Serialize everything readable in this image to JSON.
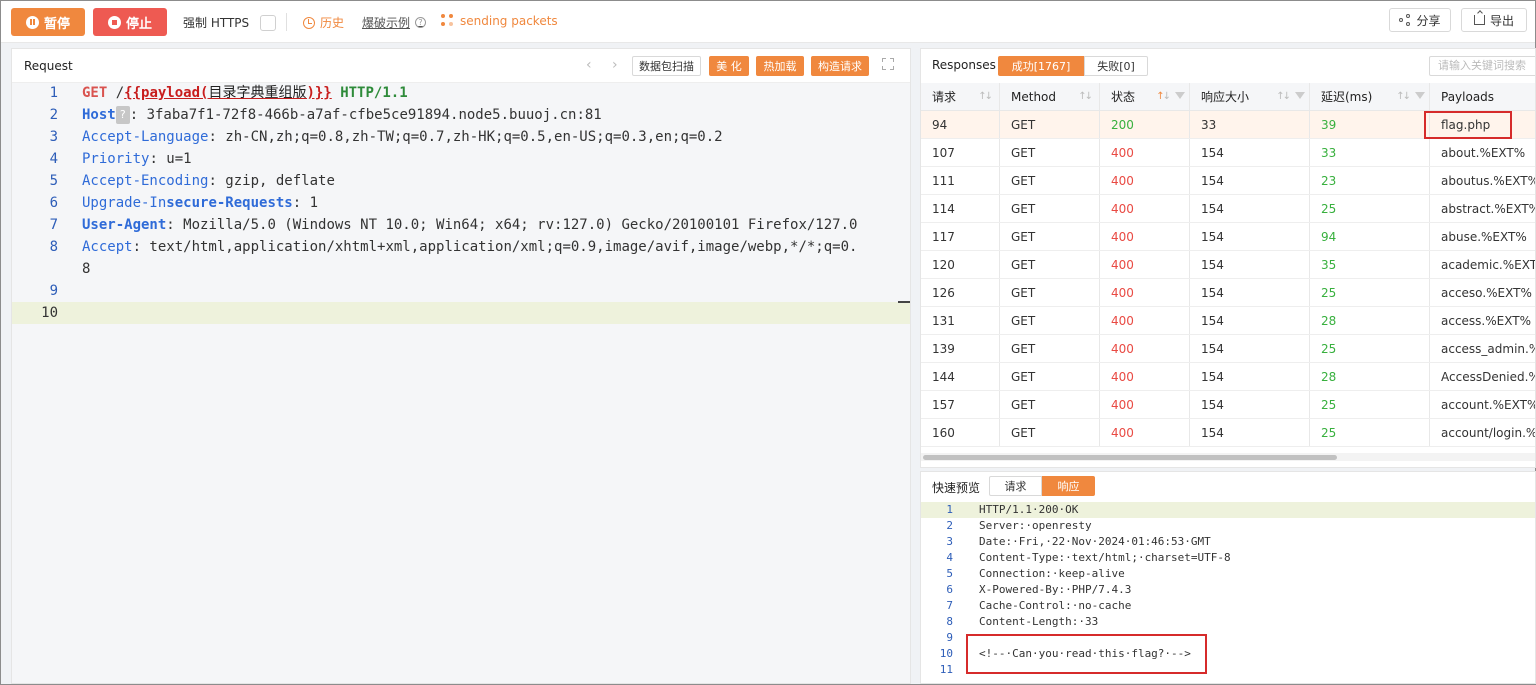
{
  "toolbar": {
    "pause_label": "暂停",
    "stop_label": "停止",
    "force_https_label": "强制 HTTPS",
    "history_label": "历史",
    "example_label": "爆破示例",
    "sending_label": "sending packets",
    "share_label": "分享",
    "export_label": "导出"
  },
  "request": {
    "title": "Request",
    "scan_label": "数据包扫描",
    "beautify_label": "美 化",
    "hotload_label": "热加载",
    "construct_label": "构造请求",
    "lines": [
      {
        "n": "1",
        "method": "GET",
        "sp": " /",
        "payload_open": "{{payload(",
        "payload_cn": "目录字典重组版",
        "payload_close": ")}}",
        "proto": "HTTP/1.1"
      },
      {
        "n": "2",
        "name": "Host",
        "q": "?",
        "value": ": 3faba7f1-72f8-466b-a7af-cfbe5ce91894.node5.buuoj.cn:81"
      },
      {
        "n": "3",
        "name": "Accept-Language",
        "value": ": zh-CN,zh;q=0.8,zh-TW;q=0.7,zh-HK;q=0.5,en-US;q=0.3,en;q=0.2"
      },
      {
        "n": "4",
        "name": "Priority",
        "value": ": u=1"
      },
      {
        "n": "5",
        "name": "Accept-Encoding",
        "value": ": gzip, deflate"
      },
      {
        "n": "6",
        "name_a": "Upgrade-In",
        "name_b": "secure-Requests",
        "value": ": 1"
      },
      {
        "n": "7",
        "name": "User-Agent",
        "value": ": Mozilla/5.0 (Windows NT 10.0; Win64; x64; rv:127.0) Gecko/20100101 Firefox/127.0"
      },
      {
        "n": "8",
        "name": "Accept",
        "value": ": text/html,application/xhtml+xml,application/xml;q=0.9,image/avif,image/webp,*/*;q=0.",
        "wrap": "8"
      },
      {
        "n": "9"
      },
      {
        "n": "10"
      }
    ]
  },
  "responses": {
    "title": "Responses",
    "success_tab": "成功[1767]",
    "fail_tab": "失败[0]",
    "search_placeholder": "请输入关键词搜索",
    "columns": [
      "请求",
      "Method",
      "状态",
      "响应大小",
      "延迟(ms)",
      "Payloads"
    ],
    "rows": [
      [
        "94",
        "GET",
        "200",
        "33",
        "39",
        "flag.php"
      ],
      [
        "107",
        "GET",
        "400",
        "154",
        "33",
        "about.%EXT%"
      ],
      [
        "111",
        "GET",
        "400",
        "154",
        "23",
        "aboutus.%EXT%"
      ],
      [
        "114",
        "GET",
        "400",
        "154",
        "25",
        "abstract.%EXT%"
      ],
      [
        "117",
        "GET",
        "400",
        "154",
        "94",
        "abuse.%EXT%"
      ],
      [
        "120",
        "GET",
        "400",
        "154",
        "35",
        "academic.%EXT%"
      ],
      [
        "126",
        "GET",
        "400",
        "154",
        "25",
        "acceso.%EXT%"
      ],
      [
        "131",
        "GET",
        "400",
        "154",
        "28",
        "access.%EXT%"
      ],
      [
        "139",
        "GET",
        "400",
        "154",
        "25",
        "access_admin.%EXT%"
      ],
      [
        "144",
        "GET",
        "400",
        "154",
        "28",
        "AccessDenied.%EXT%"
      ],
      [
        "157",
        "GET",
        "400",
        "154",
        "25",
        "account.%EXT%"
      ],
      [
        "160",
        "GET",
        "400",
        "154",
        "25",
        "account/login.%EXT%"
      ]
    ]
  },
  "preview": {
    "label": "快速预览",
    "req_tab": "请求",
    "resp_tab": "响应",
    "lines": [
      {
        "n": "1",
        "text": "HTTP/1.1·200·OK"
      },
      {
        "n": "2",
        "text": "Server:·openresty"
      },
      {
        "n": "3",
        "text": "Date:·Fri,·22·Nov·2024·01:46:53·GMT"
      },
      {
        "n": "4",
        "text": "Content-Type:·text/html;·charset=UTF-8"
      },
      {
        "n": "5",
        "text": "Connection:·keep-alive"
      },
      {
        "n": "6",
        "text": "X-Powered-By:·PHP/7.4.3"
      },
      {
        "n": "7",
        "text": "Cache-Control:·no-cache"
      },
      {
        "n": "8",
        "text": "Content-Length:·33"
      },
      {
        "n": "9",
        "text": ""
      },
      {
        "n": "10",
        "text": "<!--·Can·you·read·this·flag?·-->"
      },
      {
        "n": "11",
        "text": ""
      }
    ]
  },
  "colors": {
    "accent": "#f0883e",
    "stop": "#ee5a52",
    "success": "#38b03e",
    "error": "#e94a43",
    "highlight_box": "#d62b2b"
  }
}
